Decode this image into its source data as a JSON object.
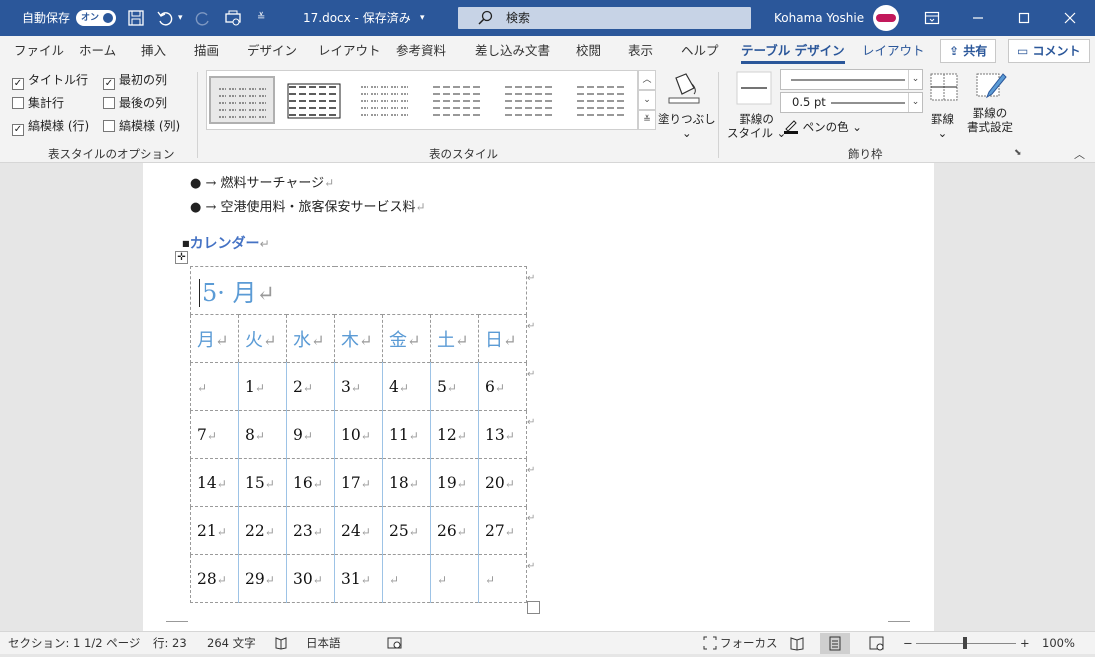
{
  "titlebar": {
    "autosave_label": "自動保存",
    "autosave_state": "オン",
    "doc_title": "17.docx - 保存済み",
    "search_placeholder": "検索",
    "user_name": "Kohama Yoshie"
  },
  "tabs": [
    {
      "label": "ファイル"
    },
    {
      "label": "ホーム"
    },
    {
      "label": "挿入"
    },
    {
      "label": "描画"
    },
    {
      "label": "デザイン"
    },
    {
      "label": "レイアウト"
    },
    {
      "label": "参考資料"
    },
    {
      "label": "差し込み文書"
    },
    {
      "label": "校閲"
    },
    {
      "label": "表示"
    },
    {
      "label": "ヘルプ"
    },
    {
      "label": "テーブル デザイン"
    },
    {
      "label": "レイアウト"
    }
  ],
  "header_buttons": {
    "share": "共有",
    "comment": "コメント"
  },
  "ribbon": {
    "style_options": {
      "header_row": "タイトル行",
      "first_column": "最初の列",
      "total_row": "集計行",
      "last_column": "最後の列",
      "banded_rows": "縞模様 (行)",
      "banded_columns": "縞模様 (列)",
      "group_label": "表スタイルのオプション"
    },
    "table_styles": {
      "group_label": "表のスタイル",
      "shading": "塗りつぶし"
    },
    "borders": {
      "border_styles_line1": "罫線の",
      "border_styles_line2": "スタイル",
      "weight": "0.5 pt",
      "pen_color": "ペンの色",
      "borders": "罫線",
      "border_painter_line1": "罫線の",
      "border_painter_line2": "書式設定",
      "group_label": "飾り枠"
    }
  },
  "document": {
    "bullet1": "→ 燃料サーチャージ",
    "bullet2": "→ 空港使用料・旅客保安サービス料",
    "heading": "カレンダー",
    "paragraph_mark": "↵",
    "calendar": {
      "title": "5· 月",
      "weekdays": [
        "月",
        "火",
        "水",
        "木",
        "金",
        "土",
        "日"
      ],
      "weeks": [
        [
          "",
          "1",
          "2",
          "3",
          "4",
          "5",
          "6"
        ],
        [
          "7",
          "8",
          "9",
          "10",
          "11",
          "12",
          "13"
        ],
        [
          "14",
          "15",
          "16",
          "17",
          "18",
          "19",
          "20"
        ],
        [
          "21",
          "22",
          "23",
          "24",
          "25",
          "26",
          "27"
        ],
        [
          "28",
          "29",
          "30",
          "31",
          "",
          "",
          ""
        ]
      ]
    }
  },
  "status": {
    "section": "セクション: 1",
    "page": "1/2 ページ",
    "line": "行: 23",
    "words": "264 文字",
    "language": "日本語",
    "focus": "フォーカス",
    "zoom_minus": "−",
    "zoom_plus": "+",
    "zoom": "100%"
  },
  "colors": {
    "brand": "#2b579a",
    "calendar_accent": "#5b9bd5",
    "heading": "#4472c4"
  }
}
